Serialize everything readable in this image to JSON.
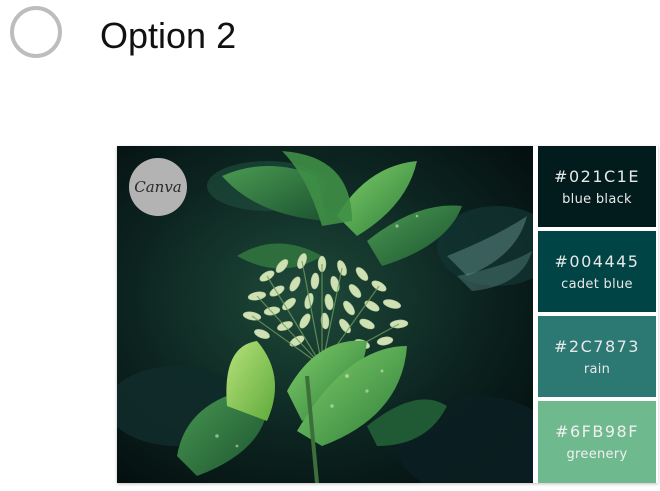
{
  "option": {
    "label": "Option 2",
    "selected": false
  },
  "image": {
    "badge_text": "Canva",
    "palette": [
      {
        "hex": "#021C1E",
        "name": "blue black",
        "color": "#021c1e",
        "text_color": "#e8e8e8"
      },
      {
        "hex": "#004445",
        "name": "cadet blue",
        "color": "#004445",
        "text_color": "#e8e8e8"
      },
      {
        "hex": "#2C7873",
        "name": "rain",
        "color": "#2c7873",
        "text_color": "#e8e8e8"
      },
      {
        "hex": "#6FB98F",
        "name": "greenery",
        "color": "#6fb98f",
        "text_color": "#f0f0f0"
      }
    ]
  }
}
